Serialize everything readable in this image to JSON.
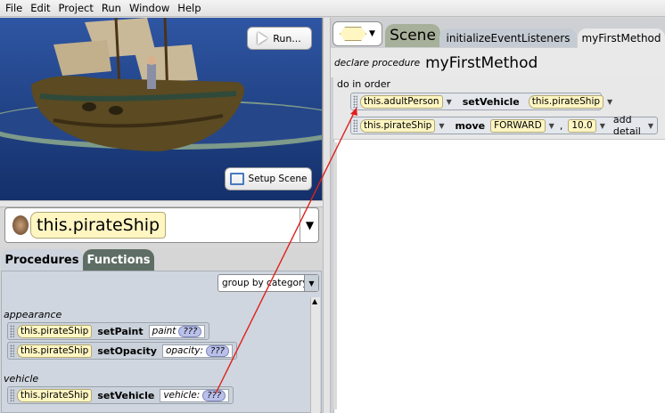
{
  "menu": [
    "File",
    "Edit",
    "Project",
    "Run",
    "Window",
    "Help"
  ],
  "viewport": {
    "run_label": "Run...",
    "setup_label": "Setup Scene"
  },
  "selector": {
    "value": "this.pirateShip"
  },
  "palette": {
    "tabs": {
      "procedures": "Procedures",
      "functions": "Functions"
    },
    "group_by": "group by category",
    "categories": {
      "appearance": "appearance",
      "vehicle": "vehicle"
    },
    "blocks": [
      {
        "target": "this.pirateShip",
        "method": "setPaint",
        "param": "paint",
        "value": "???"
      },
      {
        "target": "this.pirateShip",
        "method": "setOpacity",
        "param": "opacity:",
        "value": "???"
      },
      {
        "target": "this.pirateShip",
        "method": "setVehicle",
        "param": "vehicle:",
        "value": "???"
      }
    ]
  },
  "editor": {
    "tabs": {
      "scene": "Scene",
      "init": "initializeEventListeners",
      "current": "myFirstMethod"
    },
    "declare": "declare procedure",
    "method_name": "myFirstMethod",
    "do_in_order": "do in order",
    "statements": [
      {
        "target": "this.adultPerson",
        "method": "setVehicle",
        "arg": "this.pirateShip"
      },
      {
        "target": "this.pirateShip",
        "method": "move",
        "direction": "FORWARD",
        "separator": ",",
        "amount": "10.0",
        "detail": "add detail"
      }
    ]
  },
  "colors": {
    "object_tile": "#fff6c2",
    "annotation_arrow": "#e0201c",
    "placeholder": "#b9c0ea"
  }
}
